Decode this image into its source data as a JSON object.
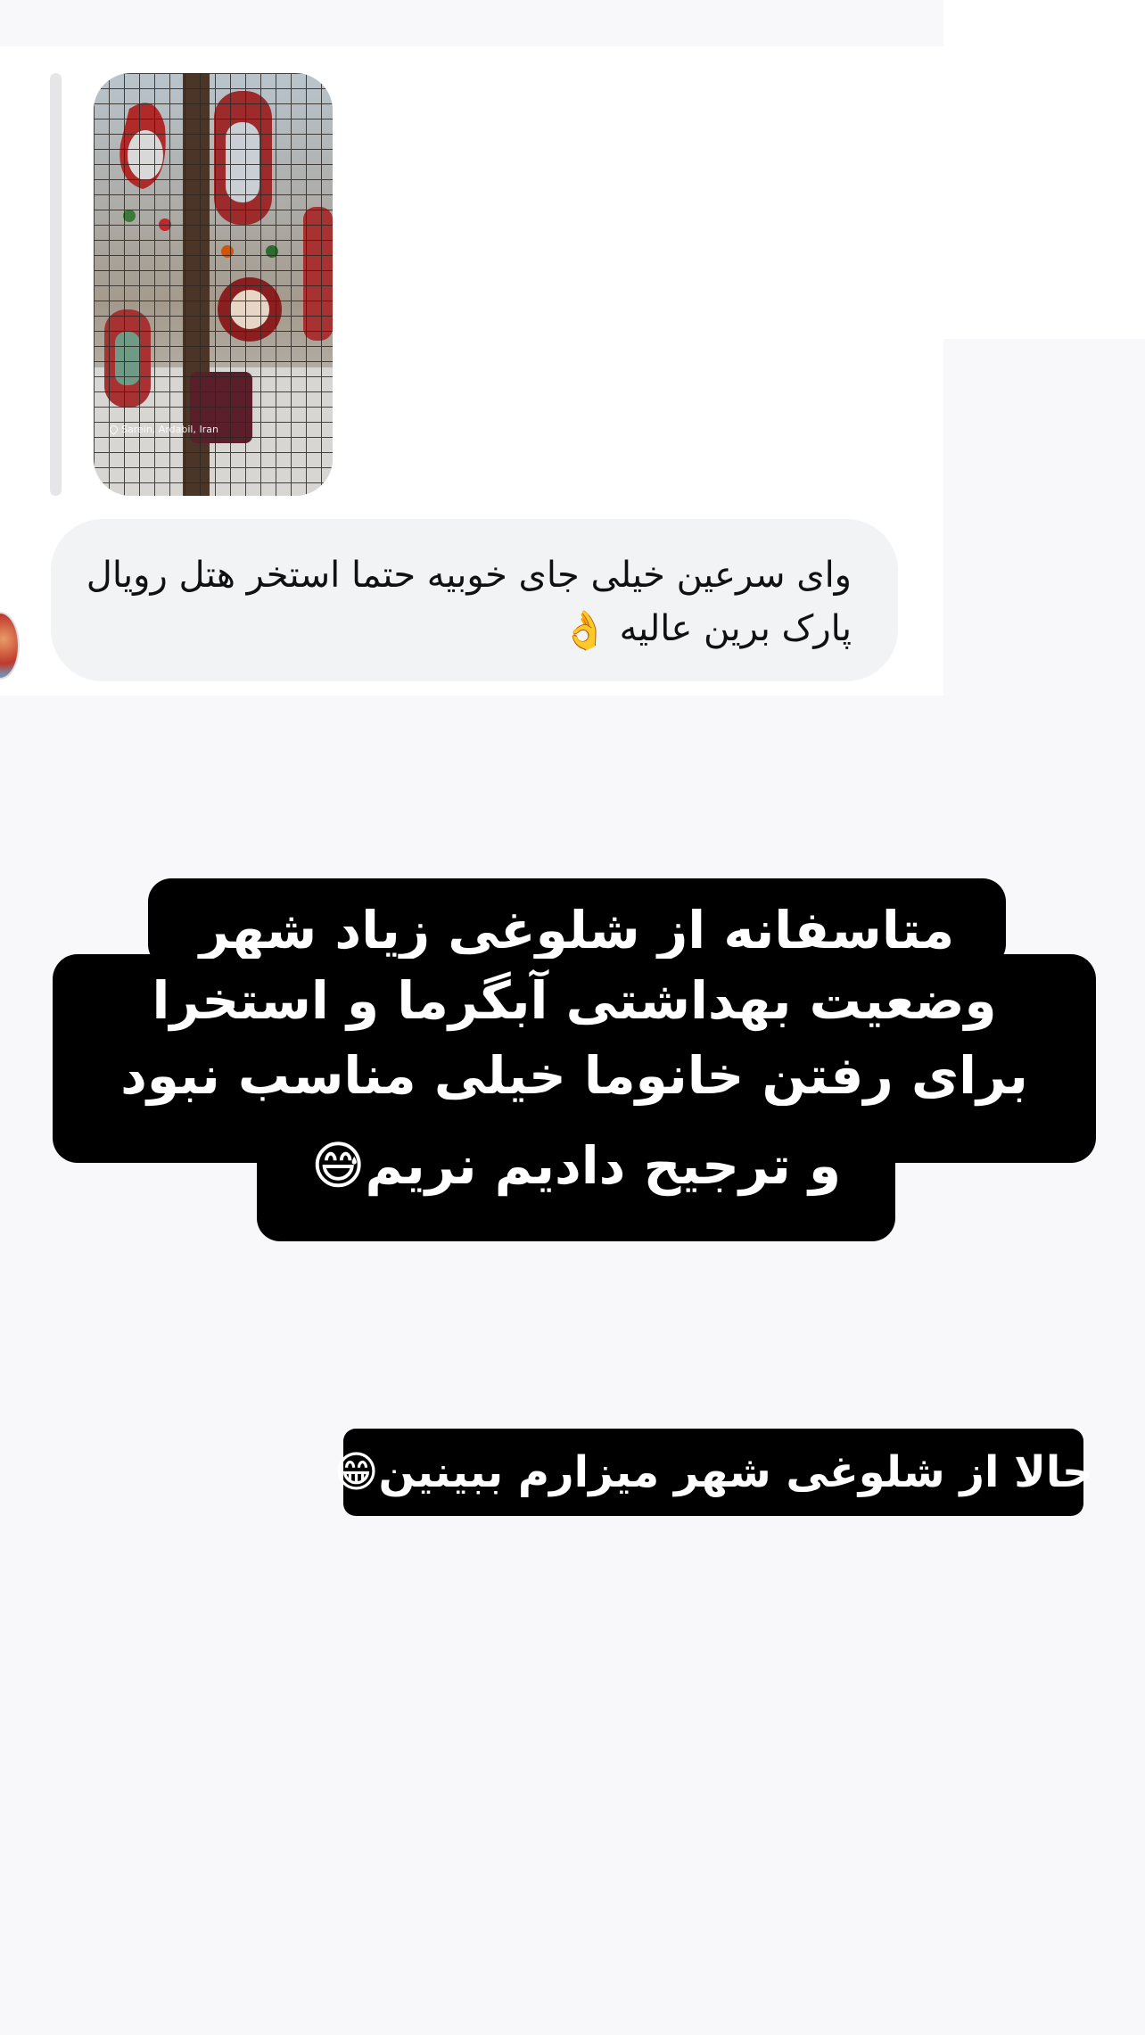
{
  "story_reply": {
    "location_tag": "Sarein, Ardabil, Iran",
    "message_text": "وای سرعین خیلی جای خوبیه حتما استخر هتل رویال پارک برین عالیه",
    "message_emoji": "👌"
  },
  "caption_main": {
    "line_1": "متاسفانه از شلوغی زیاد شهر",
    "line_2": "وضعیت بهداشتی آبگرما و استخرا",
    "line_3": "برای رفتن خانوما خیلی مناسب نبود",
    "line_4": "و ترجیح دادیم نریم😅"
  },
  "caption_secondary": {
    "text": "حالا از شلوغی شهر میزارم ببینین😁"
  },
  "colors": {
    "background": "#f8f8fa",
    "bubble": "#f2f3f5",
    "caption_bg": "#000000",
    "caption_text": "#ffffff"
  }
}
